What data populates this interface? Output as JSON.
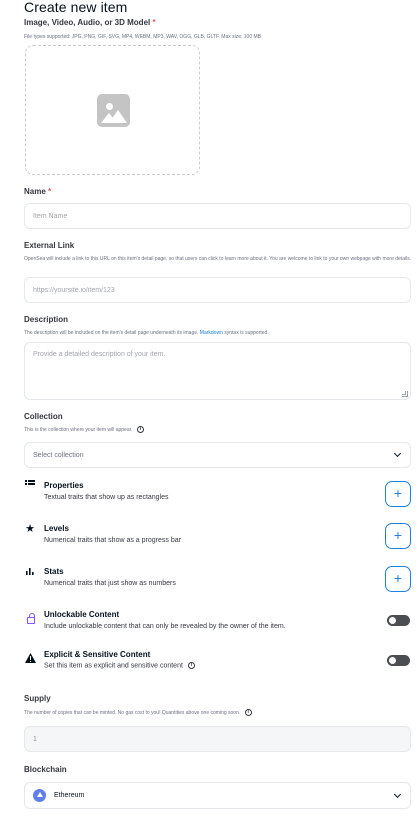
{
  "page": {
    "title": "Create new item"
  },
  "media": {
    "label": "Image, Video, Audio, or 3D Model",
    "required_mark": "*",
    "help": "File types supported: JPG, PNG, GIF, SVG, MP4, WEBM, MP3, WAV, OGG, GLB, GLTF. Max size: 100 MB",
    "icon": "image-icon"
  },
  "name": {
    "label": "Name",
    "required_mark": "*",
    "placeholder": "Item Name",
    "value": ""
  },
  "external_link": {
    "label": "External Link",
    "help": "OpenSea will include a link to this URL on this item's detail page, so that users can click to learn more about it. You are welcome to link to your own webpage with more details.",
    "placeholder": "https://yoursite.io/item/123",
    "value": ""
  },
  "description": {
    "label": "Description",
    "help_before": "The description will be included on the item's detail page underneath its image. ",
    "help_link": "Markdown",
    "help_after": " syntax is supported.",
    "placeholder": "Provide a detailed description of your item.",
    "value": ""
  },
  "collection": {
    "label": "Collection",
    "help": "This is the collection where your item will appear.",
    "selected": "Select collection"
  },
  "properties": {
    "title": "Properties",
    "subtitle": "Textual traits that show up as rectangles",
    "icon": "list-icon",
    "button": "+"
  },
  "levels": {
    "title": "Levels",
    "subtitle": "Numerical traits that show as a progress bar",
    "icon": "star-icon",
    "button": "+"
  },
  "stats": {
    "title": "Stats",
    "subtitle": "Numerical traits that just show as numbers",
    "icon": "bar-chart-icon",
    "button": "+"
  },
  "unlockable": {
    "title": "Unlockable Content",
    "subtitle": "Include unlockable content that can only be revealed by the owner of the item.",
    "icon": "lock-icon",
    "enabled": false
  },
  "explicit": {
    "title": "Explicit & Sensitive Content",
    "subtitle": "Set this item as explicit and sensitive content",
    "icon": "warning-icon",
    "enabled": false
  },
  "supply": {
    "label": "Supply",
    "help": "The number of copies that can be minted. No gas cost to you! Quantities above one coming soon.",
    "value": "1"
  },
  "blockchain": {
    "label": "Blockchain",
    "selected": "Ethereum",
    "icon": "ethereum-icon"
  },
  "colors": {
    "accent": "#2081e2",
    "required": "#eb5757",
    "toggle_off": "#4a4d52"
  }
}
